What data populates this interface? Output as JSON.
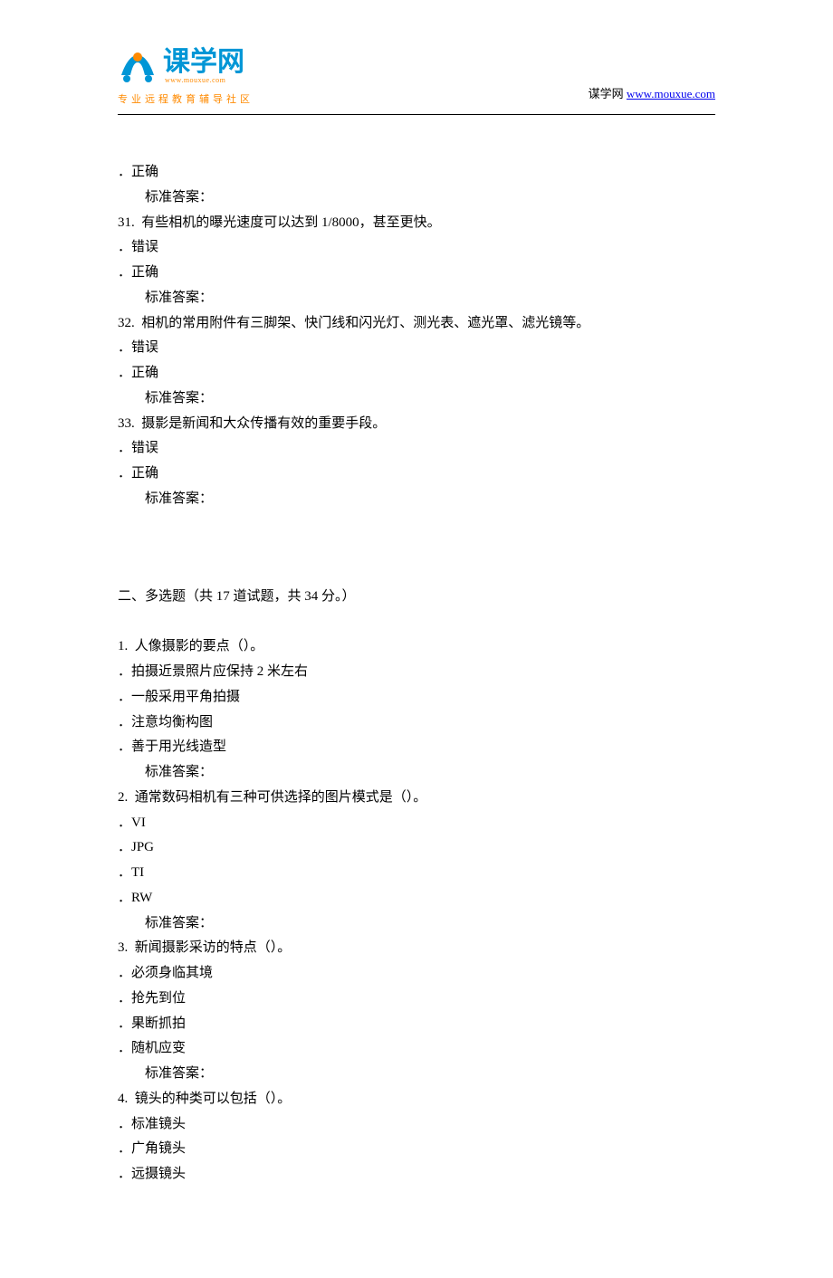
{
  "header": {
    "logo_main": "课学网",
    "logo_url_small": "www.mouxue.com",
    "logo_tagline": "专业远程教育辅导社区",
    "site_label": "谋学网",
    "site_url": "www.mouxue.com"
  },
  "tf_fragment": {
    "correct_orphan": "．正确",
    "answer_label_30": "标准答案：",
    "q31_num": "31.",
    "q31_text": "有些相机的曝光速度可以达到 1/8000，甚至更快。",
    "q31_opt_wrong": "．错误",
    "q31_opt_correct": "．正确",
    "answer_label_31": "标准答案：",
    "q32_num": "32.",
    "q32_text": "相机的常用附件有三脚架、快门线和闪光灯、测光表、遮光罩、滤光镜等。",
    "q32_opt_wrong": "．错误",
    "q32_opt_correct": "．正确",
    "answer_label_32": "标准答案：",
    "q33_num": "33.",
    "q33_text": "摄影是新闻和大众传播有效的重要手段。",
    "q33_opt_wrong": "．错误",
    "q33_opt_correct": "．正确",
    "answer_label_33": "标准答案："
  },
  "section2": {
    "heading": "二、多选题（共 17 道试题，共 34 分。）",
    "q1_num": "1.",
    "q1_text": "人像摄影的要点（）。",
    "q1_a": "．拍摄近景照片应保持 2 米左右",
    "q1_b": "．一般采用平角拍摄",
    "q1_c": "．注意均衡构图",
    "q1_d": "．善于用光线造型",
    "answer_label_1": "标准答案：",
    "q2_num": "2.",
    "q2_text": "通常数码相机有三种可供选择的图片模式是（）。",
    "q2_a": "．VI",
    "q2_b": "．JPG",
    "q2_c": "．TI",
    "q2_d": "．RW",
    "answer_label_2": "标准答案：",
    "q3_num": "3.",
    "q3_text": "新闻摄影采访的特点（）。",
    "q3_a": "．必须身临其境",
    "q3_b": "．抢先到位",
    "q3_c": "．果断抓拍",
    "q3_d": "．随机应变",
    "answer_label_3": "标准答案：",
    "q4_num": "4.",
    "q4_text": "镜头的种类可以包括（）。",
    "q4_a": "．标准镜头",
    "q4_b": "．广角镜头",
    "q4_c": "．远摄镜头"
  }
}
